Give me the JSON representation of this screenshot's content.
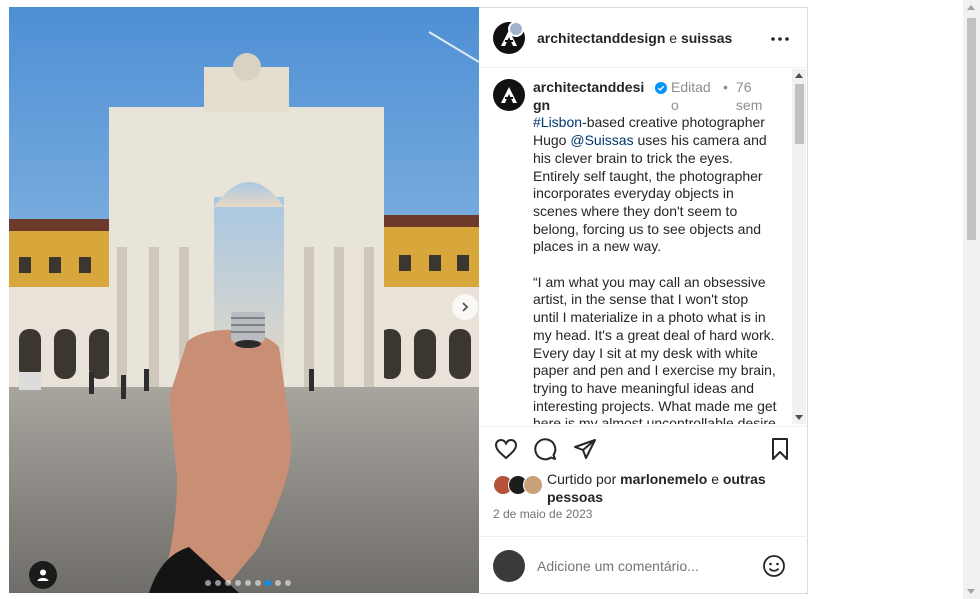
{
  "post": {
    "author": "architectanddesign",
    "connector": "e",
    "collaborator": "suissas",
    "caption": {
      "username": "architectanddesign",
      "edited_label": "Editado",
      "separator": "•",
      "time_ago": "76 sem",
      "hashtag": "#Lisbon",
      "line1_rest": "-based creative photographer Hugo ",
      "mention": "@Suissas",
      "line1_tail": " uses his camera and his clever brain to trick the eyes. Entirely self taught, the photographer incorporates everyday objects in scenes where they don't seem to belong, forcing us to see objects and places in a new way.",
      "paragraph2": "“I am what you may call an obsessive artist, in the sense that I won't stop until I materialize in a photo what is in my head. It's a great deal of hard work. Every day I sit at my desk with white paper and pen and I exercise my brain, trying to have meaningful ideas and interesting projects. What made me get here is my almost uncontrollable desire"
    },
    "likes": {
      "prefix": "Curtido por",
      "user": "marlonemelo",
      "connector": "e",
      "others": "outras pessoas"
    },
    "date": "2 de maio de 2023",
    "comment_placeholder": "Adicione um comentário..."
  },
  "carousel": {
    "total": 9,
    "current": 7
  },
  "icons": {
    "more": "more-options-icon",
    "like": "heart-icon",
    "comment": "comment-icon",
    "share": "share-icon",
    "save": "bookmark-icon",
    "emoji": "emoji-icon",
    "next": "chevron-right-icon",
    "user_tag": "user-icon",
    "verified": "verified-badge-icon"
  },
  "colors": {
    "link": "#00376b",
    "verified": "#0095f6",
    "muted": "#8e8e8e"
  }
}
